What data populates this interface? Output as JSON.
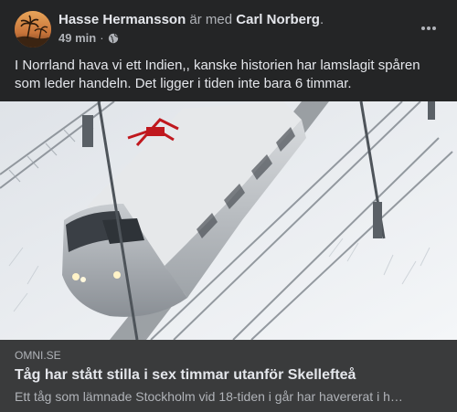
{
  "author": {
    "name": "Hasse Hermansson",
    "connector": "är med",
    "tagged": "Carl Norberg",
    "tail": "."
  },
  "meta": {
    "time": "49 min",
    "separator": "·",
    "privacy_icon": "globe-icon"
  },
  "menu_icon": "more-options-icon",
  "post_text": "I Norrland hava vi ett Indien,, kanske historien har lamslagit spåren som leder handeln. Det ligger i tiden inte bara 6 timmar.",
  "link": {
    "domain": "OMNI.SE",
    "title": "Tåg har stått stilla i sex timmar utanför Skellefteå",
    "description": "Ett tåg som lämnade Stockholm vid 18-tiden i går har havererat i h…"
  },
  "colors": {
    "background": "#242526",
    "link_box": "#3a3b3c",
    "primary_text": "#e4e6eb",
    "secondary_text": "#b0b3b8"
  }
}
